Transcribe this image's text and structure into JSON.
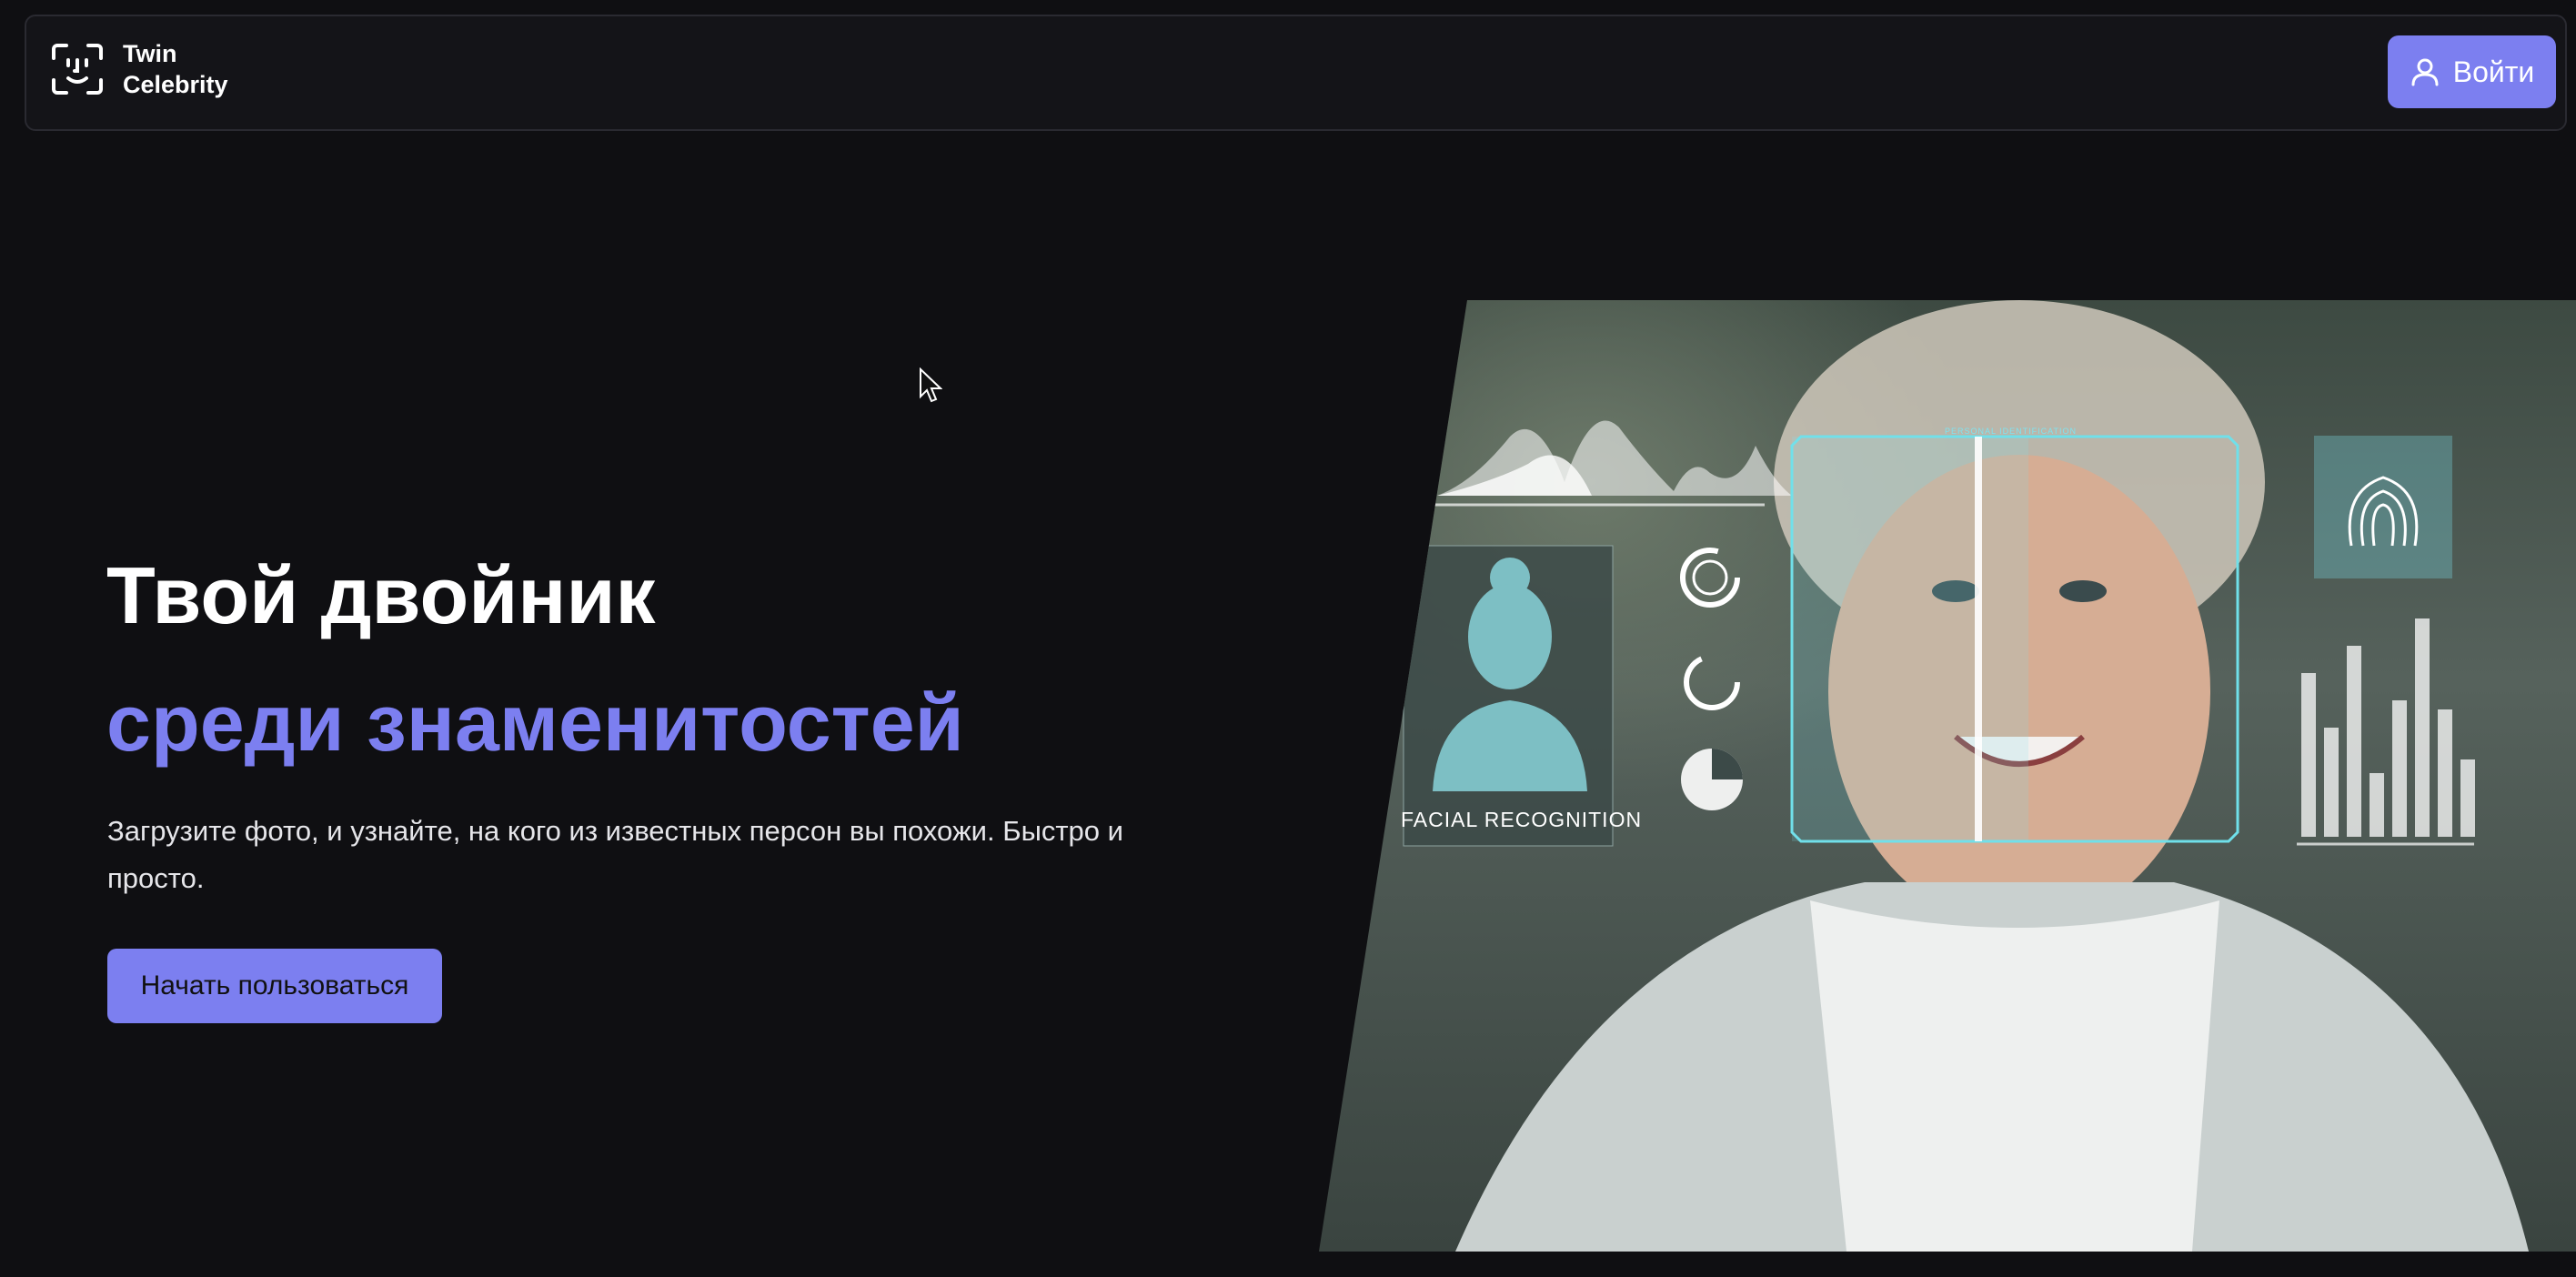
{
  "header": {
    "logo_line1": "Twin",
    "logo_line2": "Celebrity",
    "login_label": "Войти"
  },
  "hero": {
    "title_line1": "Твой двойник",
    "title_line2": "среди знаменитостей",
    "description": "Загрузите фото, и узнайте, на кого из известных персон вы похожи. Быстро и просто.",
    "cta_label": "Начать пользоваться"
  },
  "image": {
    "facial_recognition_label": "FACIAL RECOGNITION",
    "personal_identification_label": "PERSONAL IDENTIFICATION"
  },
  "colors": {
    "accent": "#7c7ff0",
    "background": "#0f0f12",
    "header_bg": "#141418",
    "hud_cyan": "#7fe3ef"
  },
  "icons": {
    "logo": "face-scan-icon",
    "login": "user-icon"
  }
}
